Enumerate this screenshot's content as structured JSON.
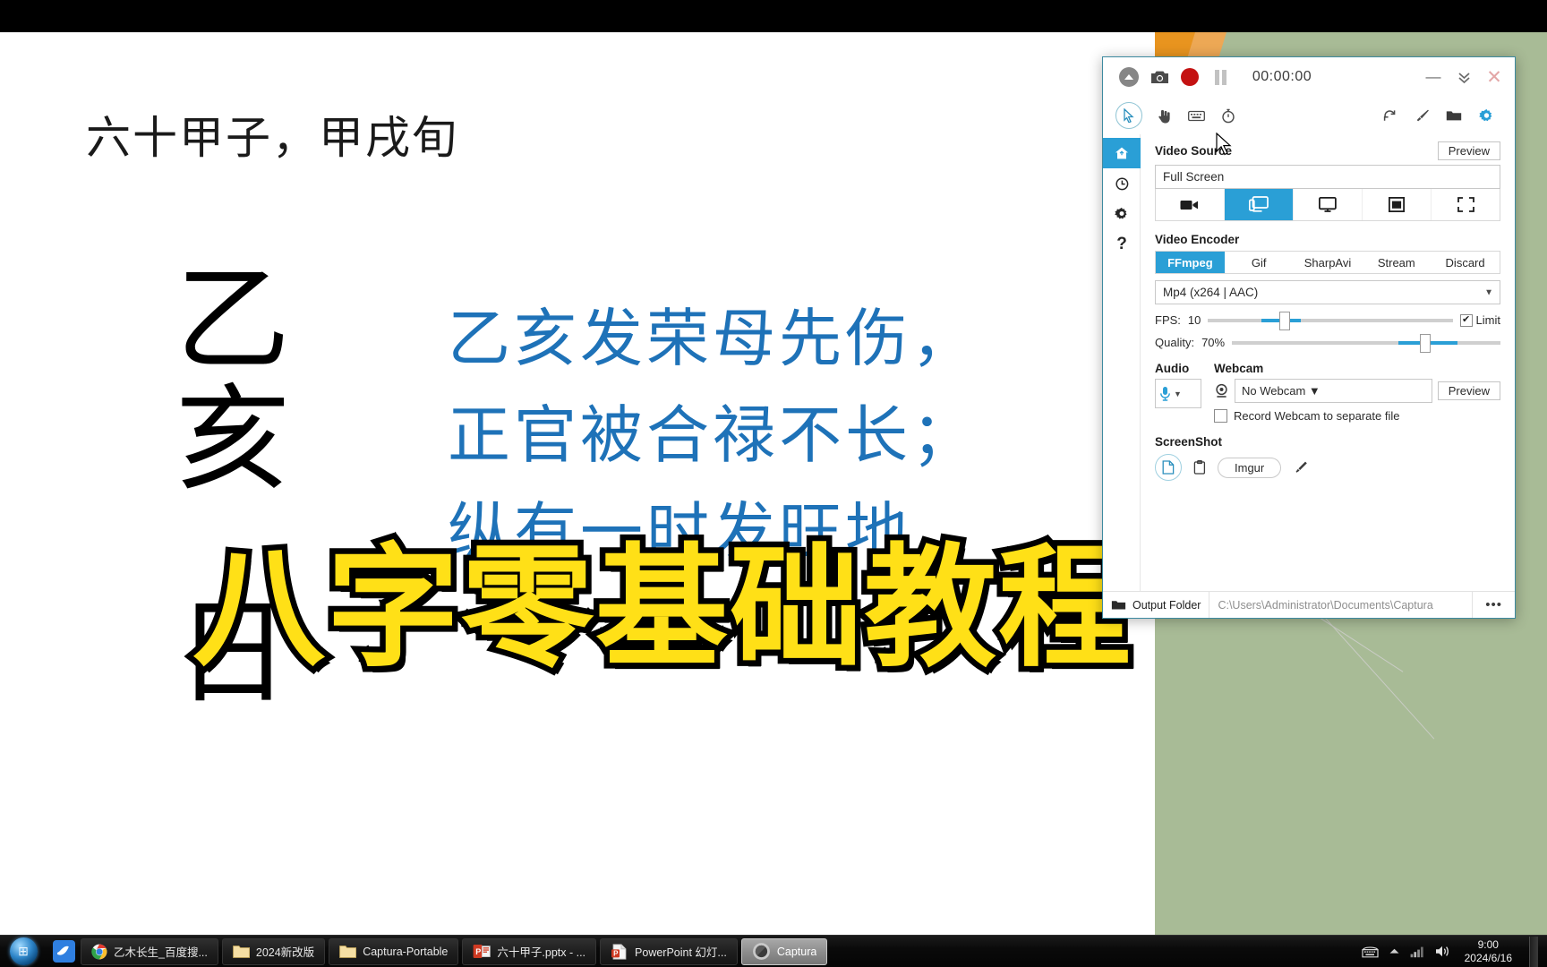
{
  "slide": {
    "title": "六十甲子，甲戌旬",
    "big_glyphs": [
      "乙",
      "亥",
      "日"
    ],
    "poem_lines": [
      "乙亥发荣母先伤，",
      "正官被合禄不长；",
      "纵有一时发旺地，"
    ],
    "poem_color": "#1e72b8",
    "banner_text": "八字零基础教程",
    "banner_color": "#ffe017",
    "banner_outline_color": "#000000"
  },
  "captura": {
    "timer": "00:00:00",
    "titlebar_icons": [
      "upload-circle-icon",
      "camera-icon",
      "record-icon",
      "pause-icon"
    ],
    "window_controls": {
      "minimize": "minimize-icon",
      "collapse": "chevron-double-down-icon",
      "close": "close-icon"
    },
    "toolbar_left": [
      "cursor-icon",
      "hand-click-icon",
      "keyboard-icon",
      "stopwatch-icon"
    ],
    "toolbar_right": [
      "refresh-icon",
      "brush-icon",
      "folder-icon",
      "gear-icon"
    ],
    "sidebar": [
      "home-icon",
      "history-icon",
      "settings-icon",
      "help-icon"
    ],
    "video_source": {
      "title": "Video Source",
      "preview_label": "Preview",
      "value": "Full Screen",
      "modes": [
        {
          "name": "video-camera-icon",
          "selected": false
        },
        {
          "name": "screen-icon",
          "selected": true
        },
        {
          "name": "monitor-icon",
          "selected": false
        },
        {
          "name": "window-icon",
          "selected": false
        },
        {
          "name": "region-icon",
          "selected": false
        }
      ]
    },
    "video_encoder": {
      "title": "Video Encoder",
      "tabs": [
        "FFmpeg",
        "Gif",
        "SharpAvi",
        "Stream",
        "Discard"
      ],
      "selected_tab": "FFmpeg",
      "format": "Mp4 (x264 | AAC)",
      "fps_label": "FPS:",
      "fps_value": "10",
      "fps_percent": 30,
      "limit_label": "Limit",
      "limit_checked": true,
      "quality_label": "Quality:",
      "quality_value": "70%",
      "quality_percent": 70
    },
    "audio": {
      "title": "Audio",
      "icon": "microphone-icon"
    },
    "webcam": {
      "title": "Webcam",
      "value": "No Webcam",
      "preview_label": "Preview",
      "separate_file_label": "Record Webcam to separate file",
      "separate_file_checked": false
    },
    "screenshot": {
      "title": "ScreenShot",
      "buttons": [
        "file-icon",
        "clipboard-icon"
      ],
      "imgur_label": "Imgur",
      "edit_icon": "pencil-icon"
    },
    "status": {
      "folder_label": "Output Folder",
      "path": "C:\\Users\\Administrator\\Documents\\Captura",
      "more_label": "•••"
    },
    "accent_color": "#2a9fd6"
  },
  "taskbar": {
    "start_icon": "windows-start-icon",
    "quick_launch": [
      "bird-app-icon"
    ],
    "items": [
      {
        "label": "乙木长生_百度搜...",
        "icon": "chrome-icon",
        "active": false
      },
      {
        "label": "2024新改版",
        "icon": "folder-icon",
        "active": false
      },
      {
        "label": "Captura-Portable",
        "icon": "folder-icon",
        "active": false
      },
      {
        "label": "六十甲子.pptx - ...",
        "icon": "powerpoint-icon",
        "active": false
      },
      {
        "label": "PowerPoint 幻灯...",
        "icon": "powerpoint-doc-icon",
        "active": false
      },
      {
        "label": "Captura",
        "icon": "captura-icon",
        "active": true
      }
    ],
    "tray_icons": [
      "ime-keyboard-icon",
      "show-hidden-icon",
      "network-icon",
      "volume-icon"
    ],
    "clock_time": "9:00",
    "clock_date": "2024/6/16"
  }
}
